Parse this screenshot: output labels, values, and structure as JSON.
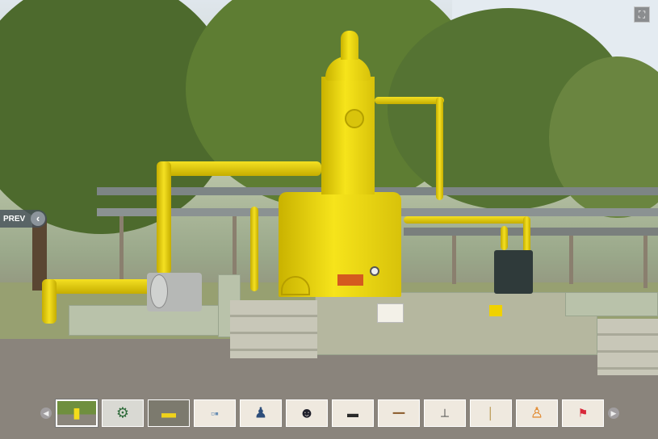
{
  "viewer": {
    "prev_label": "PREV",
    "prev_icon": "chevron-left-icon",
    "fullscreen_icon": "fullscreen-icon",
    "next_icon": "chevron-right-icon"
  },
  "thumbnails": [
    {
      "name": "thumb-scrubber-tower",
      "icon": "tower-icon",
      "active": true
    },
    {
      "name": "thumb-machine",
      "icon": "machine-icon"
    },
    {
      "name": "thumb-yellow-equipment",
      "icon": "equipment-icon"
    },
    {
      "name": "thumb-devices",
      "icon": "devices-icon"
    },
    {
      "name": "thumb-worker-equipment",
      "icon": "worker-icon"
    },
    {
      "name": "thumb-gas-mask",
      "icon": "gas-mask-icon"
    },
    {
      "name": "thumb-hose-clamps",
      "icon": "hose-icon"
    },
    {
      "name": "thumb-pipe",
      "icon": "pipe-icon"
    },
    {
      "name": "thumb-cylinder-trolley",
      "icon": "trolley-icon"
    },
    {
      "name": "thumb-rod",
      "icon": "rod-icon"
    },
    {
      "name": "thumb-orange-suit",
      "icon": "suit-icon"
    },
    {
      "name": "thumb-windsock",
      "icon": "windsock-icon"
    }
  ]
}
